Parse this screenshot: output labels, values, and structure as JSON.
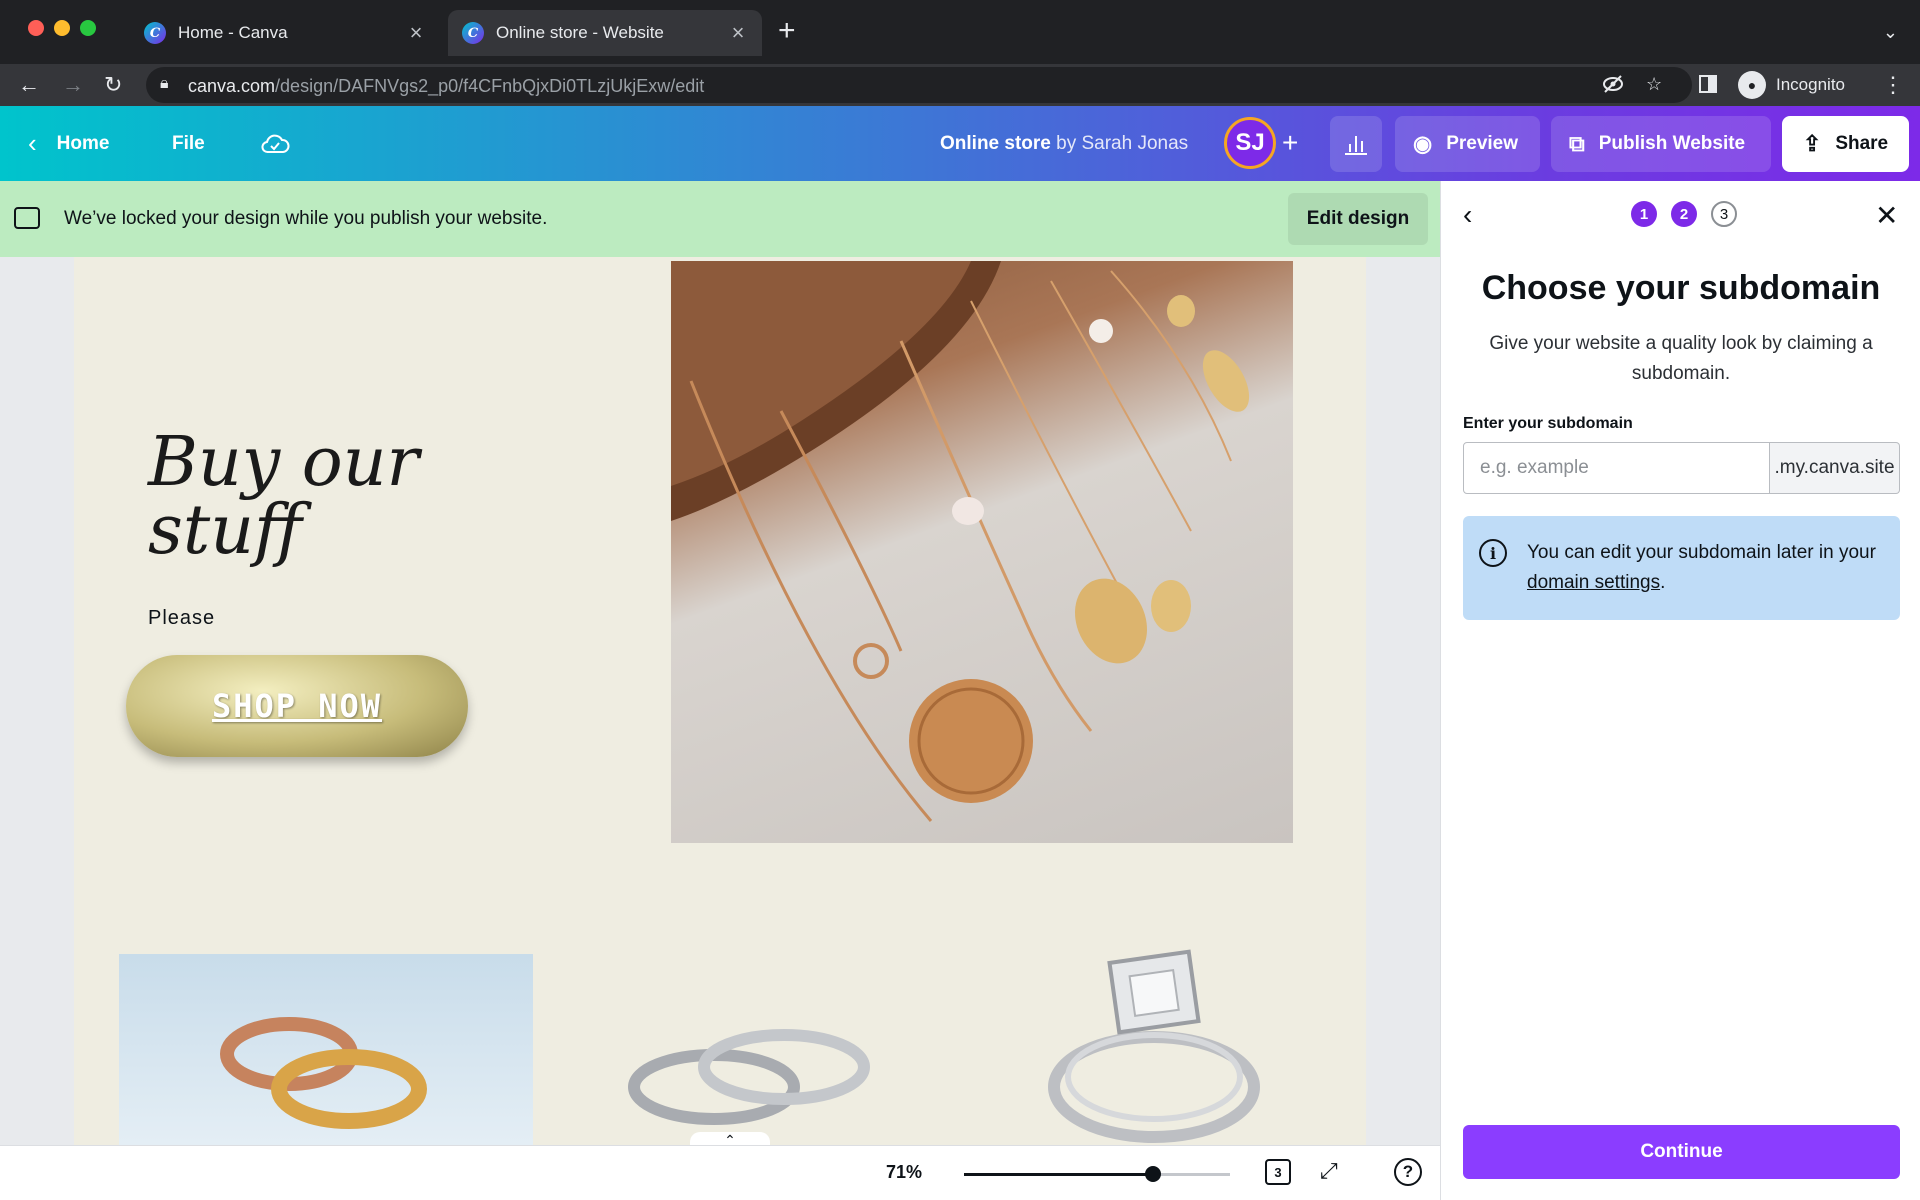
{
  "browser": {
    "tabs": [
      {
        "title": "Home - Canva",
        "favicon": "canva-logo",
        "active": false
      },
      {
        "title": "Online store - Website",
        "favicon": "canva-logo",
        "active": true
      }
    ],
    "url_host": "canva.com",
    "url_path": "/design/DAFNVgs2_p0/f4CFnbQjxDi0TLzjUkjExw/edit",
    "profile_label": "Incognito",
    "close_glyph": "×",
    "newtab_glyph": "+"
  },
  "header": {
    "home_label": "Home",
    "file_label": "File",
    "doc_title": "Online store",
    "doc_owner": "by Sarah Jonas",
    "avatar_initials": "SJ",
    "preview_label": "Preview",
    "publish_label": "Publish Website",
    "share_label": "Share",
    "accent_color": "#7d2ae8"
  },
  "banner": {
    "message": "We’ve locked your design while you publish your website.",
    "edit_label": "Edit design",
    "color": "#bcebc0"
  },
  "design": {
    "hero_title_line1": "Buy our",
    "hero_title_line2": "stuff",
    "hero_sub": "Please",
    "shop_button": "SHOP NOW"
  },
  "bottom": {
    "zoom_label": "71%",
    "zoom_fraction": 0.71,
    "page_count": "3"
  },
  "panel": {
    "steps": [
      "1",
      "2",
      "3"
    ],
    "active_steps": 2,
    "title": "Choose your subdomain",
    "description": "Give your website a quality look by claiming a subdomain.",
    "field_label": "Enter your subdomain",
    "placeholder": "e.g. example",
    "suffix": ".my.canva.site",
    "info_text": "You can edit your subdomain later in your",
    "info_link": "domain settings",
    "info_end": ".",
    "continue_label": "Continue"
  }
}
